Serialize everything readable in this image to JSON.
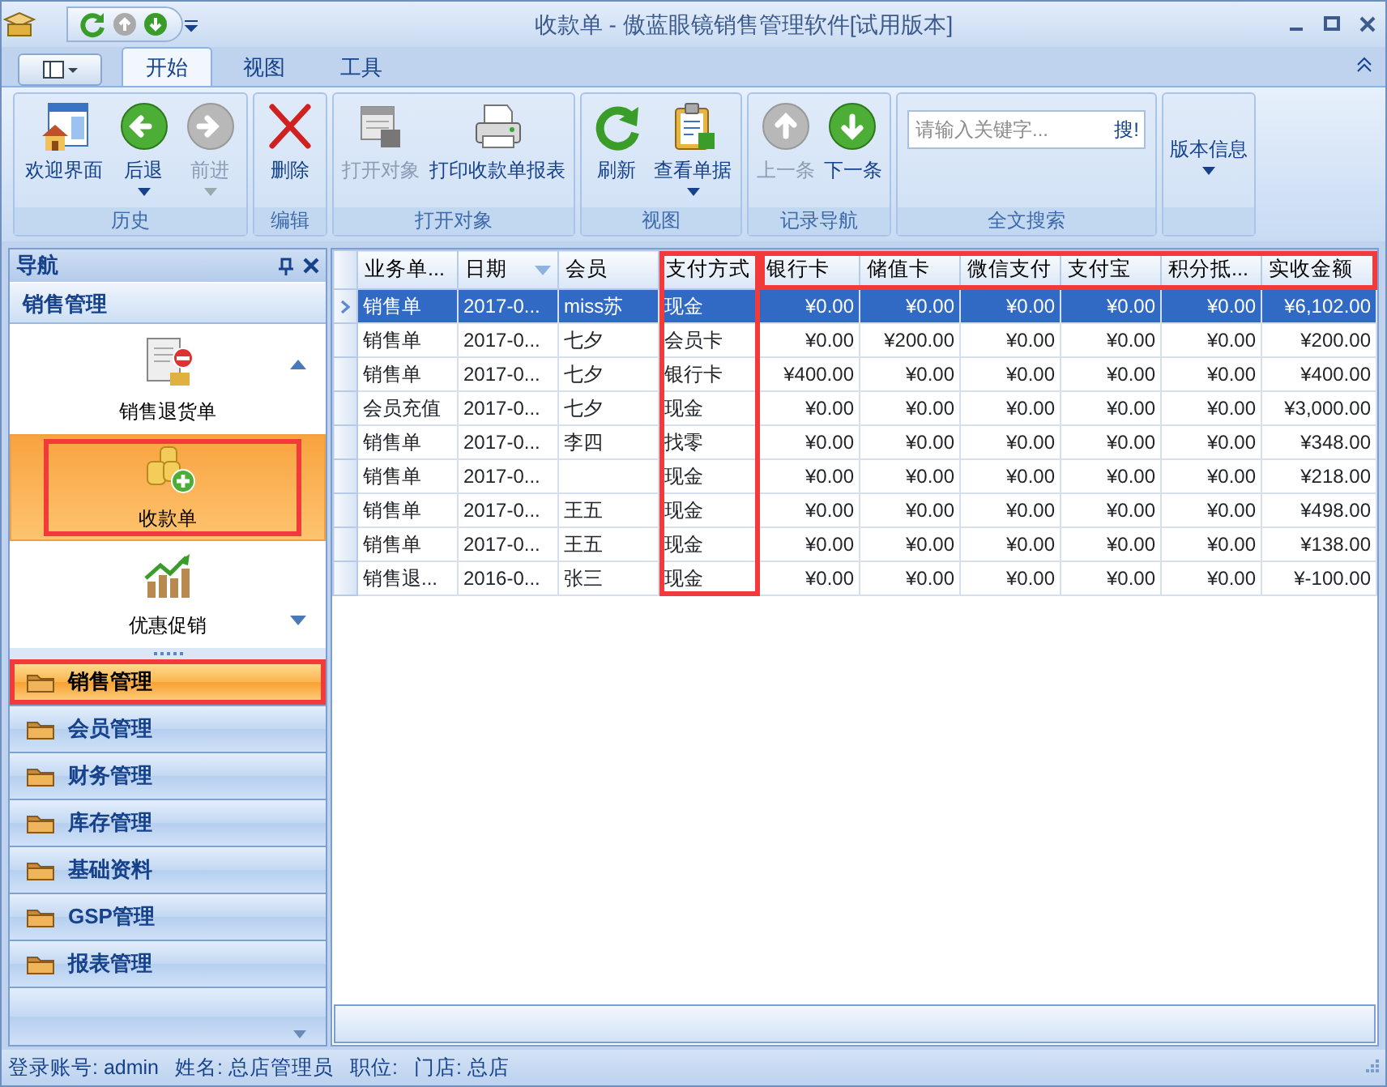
{
  "window": {
    "title": "收款单 - 傲蓝眼镜销售管理软件[试用版本]"
  },
  "ribbon": {
    "tabs": [
      {
        "label": "开始",
        "selected": true
      },
      {
        "label": "视图",
        "selected": false
      },
      {
        "label": "工具",
        "selected": false
      }
    ],
    "groups": [
      {
        "label": "历史",
        "buttons": [
          {
            "label": "欢迎界面",
            "kind": "home",
            "disabled": false,
            "dropdown": false
          },
          {
            "label": "后退",
            "kind": "back",
            "disabled": false,
            "dropdown": true
          },
          {
            "label": "前进",
            "kind": "forward",
            "disabled": true,
            "dropdown": true
          }
        ]
      },
      {
        "label": "编辑",
        "buttons": [
          {
            "label": "删除",
            "kind": "delete",
            "disabled": false,
            "dropdown": false
          }
        ]
      },
      {
        "label": "打开对象",
        "buttons": [
          {
            "label": "打开对象",
            "kind": "open",
            "disabled": true,
            "dropdown": false
          },
          {
            "label": "打印收款单报表",
            "kind": "print",
            "disabled": false,
            "dropdown": false
          }
        ]
      },
      {
        "label": "视图",
        "buttons": [
          {
            "label": "刷新",
            "kind": "refresh",
            "disabled": false,
            "dropdown": false
          },
          {
            "label": "查看单据",
            "kind": "clipboard",
            "disabled": false,
            "dropdown": true
          }
        ]
      },
      {
        "label": "记录导航",
        "buttons": [
          {
            "label": "上一条",
            "kind": "up",
            "disabled": true,
            "dropdown": false
          },
          {
            "label": "下一条",
            "kind": "down",
            "disabled": false,
            "dropdown": false
          }
        ]
      },
      {
        "label": "全文搜索",
        "search": {
          "placeholder": "请输入关键字...",
          "button": "搜!"
        }
      },
      {
        "buttons": [
          {
            "label": "版本信息",
            "kind": "text",
            "disabled": false,
            "dropdown": true
          }
        ]
      }
    ]
  },
  "nav": {
    "title": "导航",
    "section": "销售管理",
    "items": [
      {
        "label": "销售退货单",
        "kind": "return",
        "selected": false,
        "marked": false
      },
      {
        "label": "收款单",
        "kind": "coins",
        "selected": true,
        "marked": true
      },
      {
        "label": "优惠促销",
        "kind": "chart",
        "selected": false,
        "marked": false
      }
    ],
    "groups": [
      {
        "label": "销售管理",
        "selected": true,
        "marked": true
      },
      {
        "label": "会员管理",
        "selected": false,
        "marked": false
      },
      {
        "label": "财务管理",
        "selected": false,
        "marked": false
      },
      {
        "label": "库存管理",
        "selected": false,
        "marked": false
      },
      {
        "label": "基础资料",
        "selected": false,
        "marked": false
      },
      {
        "label": "GSP管理",
        "selected": false,
        "marked": false
      },
      {
        "label": "报表管理",
        "selected": false,
        "marked": false
      }
    ]
  },
  "grid": {
    "columns": [
      {
        "label": "业务单...",
        "kind": "text",
        "sorted": false,
        "marked": false
      },
      {
        "label": "日期",
        "kind": "text",
        "sorted": true,
        "marked": false
      },
      {
        "label": "会员",
        "kind": "text",
        "sorted": false,
        "marked": false
      },
      {
        "label": "支付方式",
        "kind": "text",
        "sorted": false,
        "marked": true
      },
      {
        "label": "银行卡",
        "kind": "money",
        "sorted": false,
        "marked": true
      },
      {
        "label": "储值卡",
        "kind": "money",
        "sorted": false,
        "marked": true
      },
      {
        "label": "微信支付",
        "kind": "money",
        "sorted": false,
        "marked": true
      },
      {
        "label": "支付宝",
        "kind": "money",
        "sorted": false,
        "marked": true
      },
      {
        "label": "积分抵...",
        "kind": "money",
        "sorted": false,
        "marked": true
      },
      {
        "label": "实收金额",
        "kind": "money",
        "sorted": false,
        "marked": true
      }
    ],
    "rows": [
      {
        "selected": true,
        "cells": [
          "销售单",
          "2017-0...",
          "miss苏",
          "现金",
          "¥0.00",
          "¥0.00",
          "¥0.00",
          "¥0.00",
          "¥0.00",
          "¥6,102.00"
        ]
      },
      {
        "selected": false,
        "cells": [
          "销售单",
          "2017-0...",
          "七夕",
          "会员卡",
          "¥0.00",
          "¥200.00",
          "¥0.00",
          "¥0.00",
          "¥0.00",
          "¥200.00"
        ]
      },
      {
        "selected": false,
        "cells": [
          "销售单",
          "2017-0...",
          "七夕",
          "银行卡",
          "¥400.00",
          "¥0.00",
          "¥0.00",
          "¥0.00",
          "¥0.00",
          "¥400.00"
        ]
      },
      {
        "selected": false,
        "cells": [
          "会员充值",
          "2017-0...",
          "七夕",
          "现金",
          "¥0.00",
          "¥0.00",
          "¥0.00",
          "¥0.00",
          "¥0.00",
          "¥3,000.00"
        ]
      },
      {
        "selected": false,
        "cells": [
          "销售单",
          "2017-0...",
          "李四",
          "找零",
          "¥0.00",
          "¥0.00",
          "¥0.00",
          "¥0.00",
          "¥0.00",
          "¥348.00"
        ]
      },
      {
        "selected": false,
        "cells": [
          "销售单",
          "2017-0...",
          "",
          "现金",
          "¥0.00",
          "¥0.00",
          "¥0.00",
          "¥0.00",
          "¥0.00",
          "¥218.00"
        ]
      },
      {
        "selected": false,
        "cells": [
          "销售单",
          "2017-0...",
          "王五",
          "现金",
          "¥0.00",
          "¥0.00",
          "¥0.00",
          "¥0.00",
          "¥0.00",
          "¥498.00"
        ]
      },
      {
        "selected": false,
        "cells": [
          "销售单",
          "2017-0...",
          "王五",
          "现金",
          "¥0.00",
          "¥0.00",
          "¥0.00",
          "¥0.00",
          "¥0.00",
          "¥138.00"
        ]
      },
      {
        "selected": false,
        "cells": [
          "销售退...",
          "2016-0...",
          "张三",
          "现金",
          "¥0.00",
          "¥0.00",
          "¥0.00",
          "¥0.00",
          "¥0.00",
          "¥-100.00"
        ]
      }
    ]
  },
  "status_bar": [
    "登录账号: admin",
    "姓名: 总店管理员",
    "职位:",
    "门店: 总店"
  ]
}
